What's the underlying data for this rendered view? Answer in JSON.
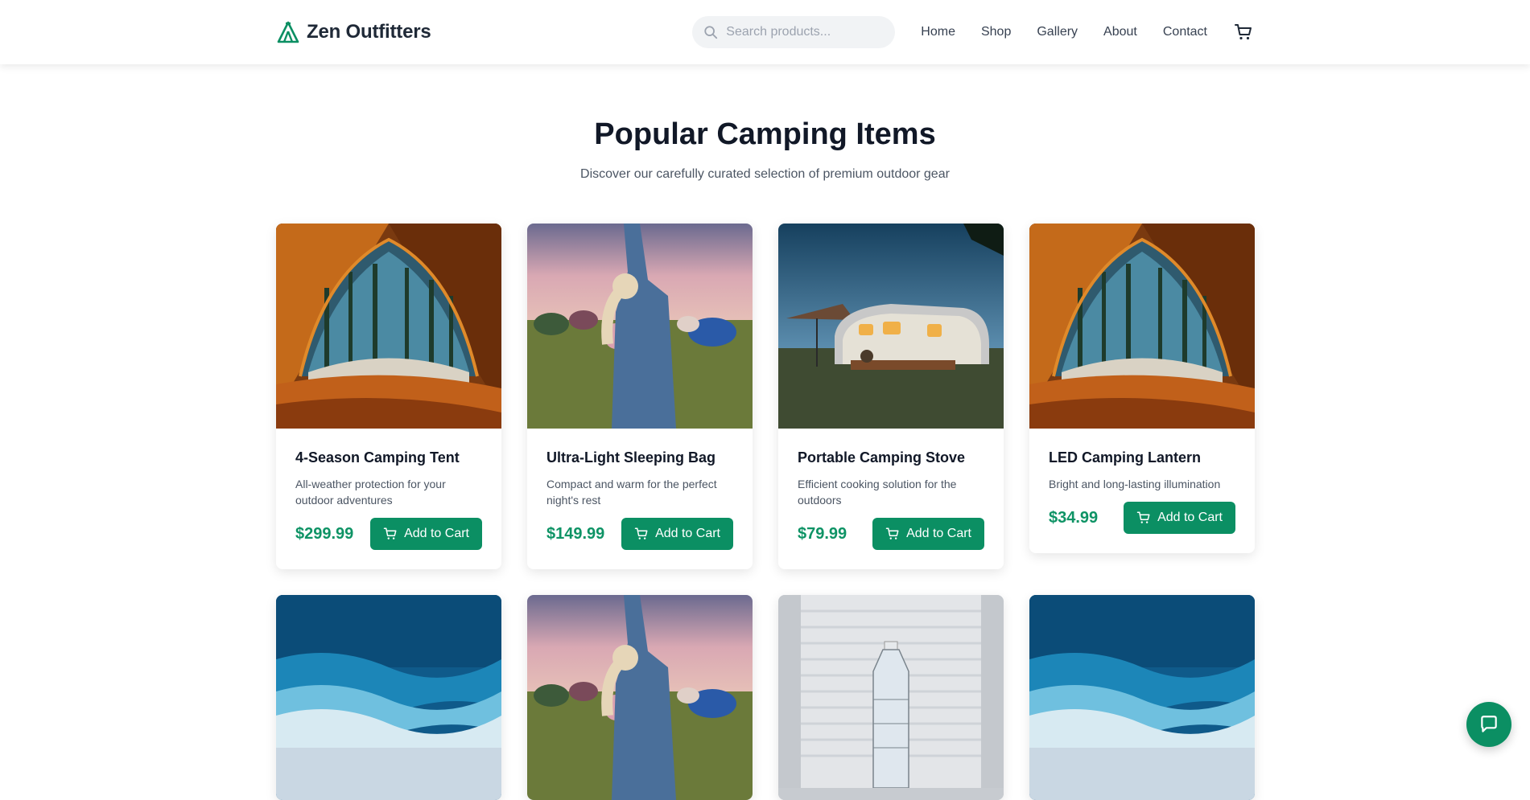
{
  "brand": {
    "name": "Zen Outfitters",
    "icon": "tent-logo-icon",
    "accent": "#0b8f63"
  },
  "search": {
    "placeholder": "Search products..."
  },
  "nav": {
    "items": [
      "Home",
      "Shop",
      "Gallery",
      "About",
      "Contact"
    ],
    "cart_icon": "cart-icon"
  },
  "hero": {
    "title": "Popular Camping Items",
    "subtitle": "Discover our carefully curated selection of premium outdoor gear"
  },
  "products": [
    {
      "title": "4-Season Camping Tent",
      "desc": "All-weather protection for your outdoor adventures",
      "price": "$299.99",
      "button": "Add to Cart",
      "image": "tent-interior-forest-view"
    },
    {
      "title": "Ultra-Light Sleeping Bag",
      "desc": "Compact and warm for the perfect night's rest",
      "price": "$149.99",
      "button": "Add to Cart",
      "image": "festival-camper-arms-raised"
    },
    {
      "title": "Portable Camping Stove",
      "desc": "Efficient cooking solution for the outdoors",
      "price": "$79.99",
      "button": "Add to Cart",
      "image": "airstream-trailer-dusk"
    },
    {
      "title": "LED Camping Lantern",
      "desc": "Bright and long-lasting illumination",
      "price": "$34.99",
      "button": "Add to Cart",
      "image": "tent-interior-forest-view"
    }
  ],
  "products_row2_images": [
    "ocean-shore-aerial",
    "festival-camper-arms-raised",
    "water-bottle",
    "ocean-shore-aerial"
  ],
  "chat": {
    "icon": "chat-bubble-icon"
  }
}
